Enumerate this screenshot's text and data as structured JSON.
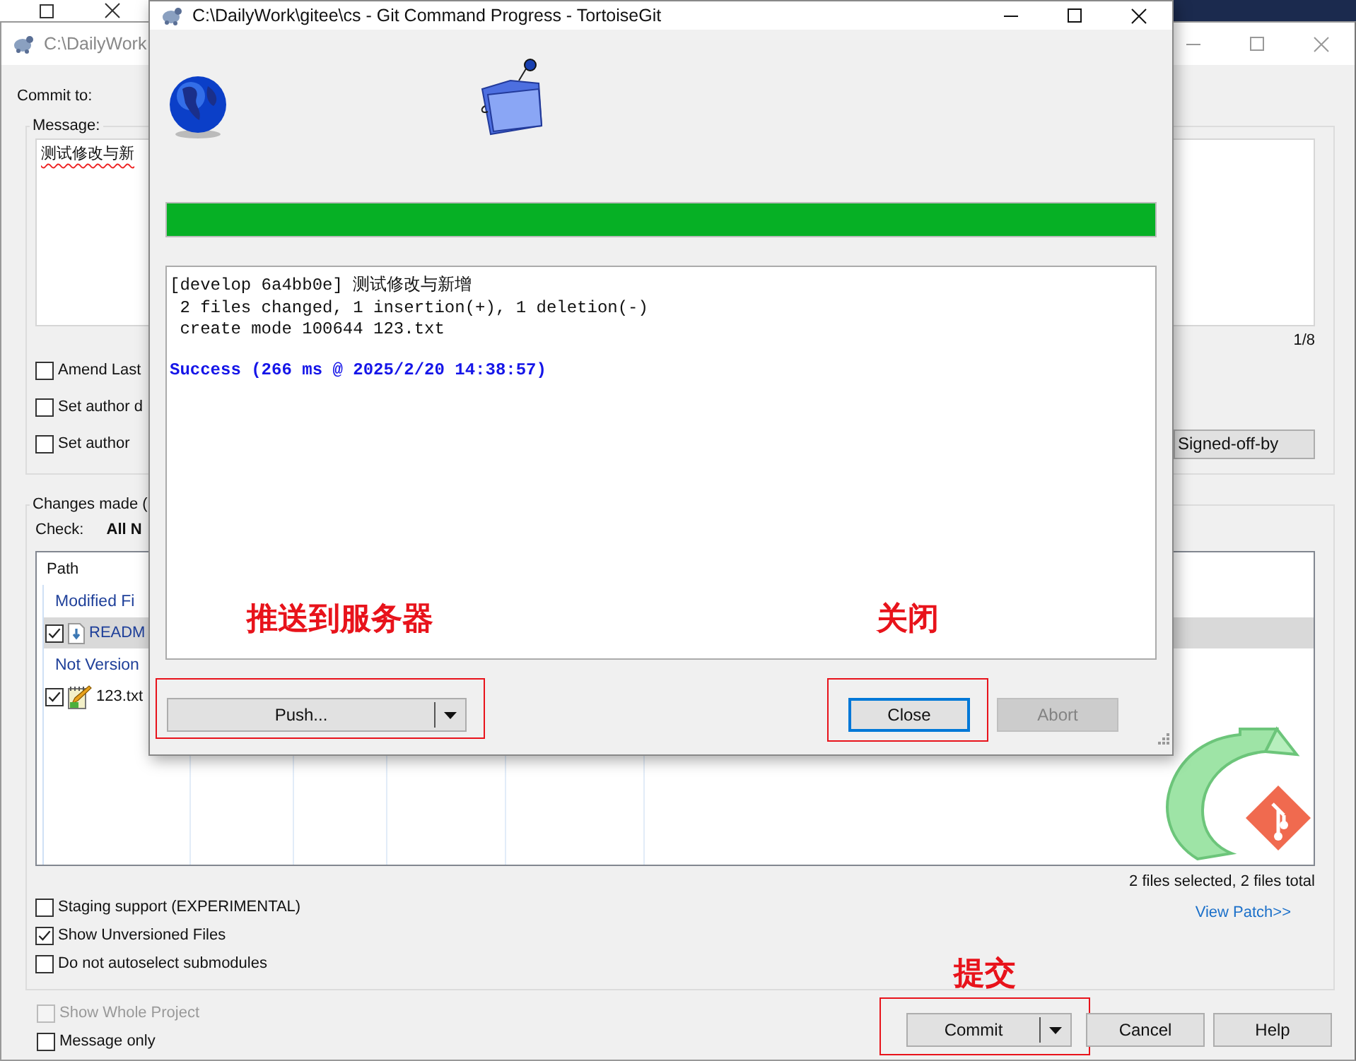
{
  "commit_dialog": {
    "title": "C:\\DailyWork",
    "commit_to_label": "Commit to:",
    "message_group": {
      "label": "Message:",
      "message": "测试修改与新",
      "counter": "1/8",
      "signed_off_button": "Signed-off-by",
      "options": [
        {
          "label": "Amend Last",
          "checked": false
        },
        {
          "label": "Set author d",
          "checked": false
        },
        {
          "label": "Set author",
          "checked": false
        }
      ]
    },
    "changes_group": {
      "label": "Changes made (",
      "check_label": "Check:",
      "check_links": [
        "All",
        "N"
      ],
      "file_list": {
        "columns": [
          "Path"
        ],
        "groups": [
          {
            "label": "Modified Fi",
            "files": [
              {
                "name": "READM",
                "kind": "modified",
                "checked": true,
                "selected": true
              }
            ]
          },
          {
            "label": "Not Version",
            "files": [
              {
                "name": "123.txt",
                "kind": "unversioned",
                "checked": true,
                "selected": false
              }
            ]
          }
        ]
      },
      "summary": "2 files selected, 2 files total",
      "view_patch": "View Patch>>",
      "options": [
        {
          "label": "Staging support (EXPERIMENTAL)",
          "checked": false
        },
        {
          "label": "Show Unversioned Files",
          "checked": true
        },
        {
          "label": "Do not autoselect submodules",
          "checked": false
        }
      ]
    },
    "bottom_options": [
      {
        "label": "Show Whole Project",
        "checked": false,
        "disabled": true
      },
      {
        "label": "Message only",
        "checked": false,
        "disabled": false
      }
    ],
    "buttons": [
      {
        "label": "Commit",
        "kind": "split",
        "highlighted": true,
        "annotation": "提交"
      },
      {
        "label": "Cancel",
        "kind": "plain",
        "highlighted": false
      },
      {
        "label": "Help",
        "kind": "plain",
        "highlighted": false
      }
    ]
  },
  "progress_dialog": {
    "title": "C:\\DailyWork\\gitee\\cs - Git Command Progress - TortoiseGit",
    "level": 1,
    "log": [
      {
        "text": "[develop 6a4bb0e] 测试修改与新增",
        "kind": "output"
      },
      {
        "text": " 2 files changed, 1 insertion(+), 1 deletion(-)",
        "kind": "output"
      },
      {
        "text": " create mode 100644 123.txt",
        "kind": "output"
      },
      {
        "text": "Success (266 ms @ 2025/2/20 14:38:57)",
        "kind": "status"
      }
    ],
    "buttons": [
      {
        "label": "Push...",
        "kind": "split",
        "highlighted": true,
        "annotation": "推送到服务器",
        "focused": false,
        "disabled": false
      },
      {
        "label": "Close",
        "kind": "plain",
        "highlighted": true,
        "annotation": "关闭",
        "focused": true,
        "disabled": false
      },
      {
        "label": "Abort",
        "kind": "plain",
        "highlighted": false,
        "focused": false,
        "disabled": true
      }
    ]
  }
}
